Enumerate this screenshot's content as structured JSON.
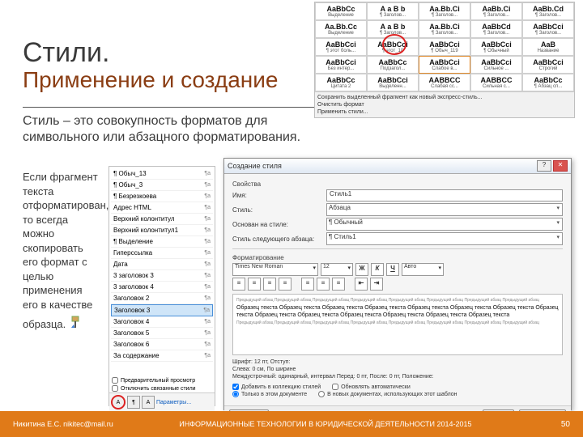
{
  "title": {
    "main": "Стили.",
    "sub": "Применение и  создание"
  },
  "definition": "Стиль – это совокупность форматов для символьного или абзацного форматирования.",
  "body": "Если фрагмент текста отформатирован, то всегда можно скопировать его формат с целью применения его в качестве образца.",
  "gallery": {
    "rows": [
      [
        {
          "s": "AaBbCc",
          "l": "Выделение"
        },
        {
          "s": "A a B b",
          "l": "¶ Заголов..."
        },
        {
          "s": "Aa.Bb.Ci",
          "l": "¶ Заголов..."
        },
        {
          "s": "AaBb.Ci",
          "l": "¶ Заголов..."
        },
        {
          "s": "AaBb.Cd",
          "l": "¶ Заголов..."
        }
      ],
      [
        {
          "s": "Aa.Bb.Cc",
          "l": "Выделение"
        },
        {
          "s": "A a B b",
          "l": "¶ Заголов..."
        },
        {
          "s": "Aa.Bb.Ci",
          "l": "¶ Заголов..."
        },
        {
          "s": "AaBbCd",
          "l": "¶ Заголов..."
        },
        {
          "s": "AaBbCci",
          "l": "¶ Заголов..."
        }
      ],
      [
        {
          "s": "AaBbCci",
          "l": "¶ этот боль..."
        },
        {
          "s": "AaBbCci",
          "l": "¶ этот_10"
        },
        {
          "s": "AaBbCci",
          "l": "¶ Обыч_119"
        },
        {
          "s": "AaBbCci",
          "l": "¶ Обычный"
        },
        {
          "s": "AaB",
          "l": "Название"
        }
      ],
      [
        {
          "s": "AaBbCci",
          "l": "Без интер..."
        },
        {
          "s": "AaBbCc",
          "l": "Подзагол..."
        },
        {
          "s": "AaBbCci",
          "l": "Слабое в..."
        },
        {
          "s": "AaBbCci",
          "l": "Сильное ..."
        },
        {
          "s": "AaBbCci",
          "l": "Строгий"
        }
      ],
      [
        {
          "s": "AaBbCc",
          "l": "Цитата 2"
        },
        {
          "s": "AaBbCci",
          "l": "Выделенн..."
        },
        {
          "s": "AABBCC",
          "l": "Слабая сс..."
        },
        {
          "s": "AABBCC",
          "l": "Сильная с..."
        },
        {
          "s": "AaBbCc",
          "l": "¶ Абзац сп..."
        }
      ]
    ],
    "footer": [
      "Сохранить выделенный фрагмент как новый экспресс-стиль...",
      "Очистить формат",
      "Применить стили..."
    ]
  },
  "pane": {
    "items": [
      "¶ Обыч_13",
      "¶ Обыч_3",
      "¶ Безрезкоева",
      "Адрес HTML",
      "Верхний колонтитул",
      "Верхний колонтитул1",
      "¶ Выделение",
      "Гиперссылка",
      "Дата",
      "3 заголовок 3",
      "3 заголовок 4",
      "Заголовок 2",
      "Заголовок 3",
      "Заголовок 4",
      "Заголовок 5",
      "Заголовок 6",
      "За содержание"
    ],
    "hiIndex": 12,
    "cb1": "Предварительный просмотр",
    "cb2": "Отключить связанные стили",
    "link": "Параметры..."
  },
  "dialog": {
    "windowTitle": "Создание стиля",
    "secProps": "Свойства",
    "lbl_name": "Имя:",
    "val_name": "Стиль1",
    "lbl_type": "Стиль:",
    "val_type": "Абзаца",
    "lbl_based": "Основан на стиле:",
    "val_based": "¶ Обычный",
    "lbl_next": "Стиль следующего абзаца:",
    "val_next": "¶ Стиль1",
    "secFmt": "Форматирование",
    "font": "Times New Roman",
    "size": "12",
    "b": "Ж",
    "i": "К",
    "u": "Ч",
    "auto": "Авто",
    "preview_tiny": "Предыдущий абзац Предыдущий абзац Предыдущий абзац Предыдущий абзац Предыдущий абзац Предыдущий абзац Предыдущий абзац Предыдущий абзац",
    "preview_sample": "Образец текста Образец текста Образец текста Образец текста Образец текста Образец текста Образец текста Образец текста Образец текста Образец текста Образец текста Образец текста Образец текста Образец текста",
    "desc": "Шрифт: 12 пт, Отступ:\nСлева: 0 см, По ширине\nМеждустрочный: одинарный, интервал Перед: 0 пт, После: 0 пт, Положение:",
    "cb_collection": "Добавить в коллекцию стилей",
    "cb_autoupd": "Обновлять автоматически",
    "rb_doc": "Только в этом документе",
    "rb_tpl": "В новых документах, использующих этот шаблон",
    "btn_format": "Формат ▾",
    "btn_ok": "OK",
    "btn_cancel": "Отмена"
  },
  "footer": {
    "left": "Никитина Е.С. nikitec@mail.ru",
    "center": "ИНФОРМАЦИОННЫЕ ТЕХНОЛОГИИ В ЮРИДИЧЕСКОЙ ДЕЯТЕЛЬНОСТИ 2014-2015",
    "page": "50"
  }
}
